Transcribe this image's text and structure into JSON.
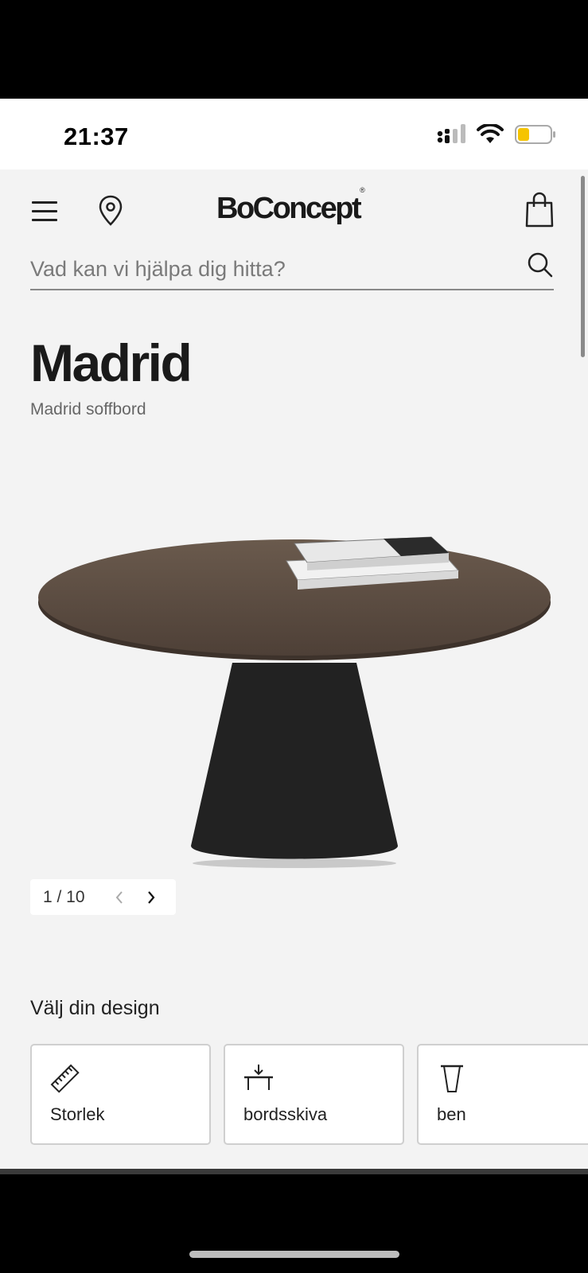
{
  "status_bar": {
    "time": "21:37",
    "icons": [
      "cellular-signal-icon",
      "wifi-icon",
      "battery-low-icon"
    ],
    "battery_color": "#f5c400"
  },
  "header": {
    "logo": "BoConcept",
    "logo_mark": "®",
    "icons": [
      "menu-icon",
      "location-pin-icon",
      "shopping-bag-icon"
    ]
  },
  "search": {
    "placeholder": "Vad kan vi hjälpa dig hitta?",
    "icon": "search-icon"
  },
  "product": {
    "title": "Madrid",
    "subtitle": "Madrid soffbord",
    "image": "round-coffee-table-with-books"
  },
  "gallery": {
    "counter": "1 / 10",
    "current": 1,
    "total": 10
  },
  "design": {
    "heading": "Välj din design",
    "options": [
      {
        "label": "Storlek",
        "icon": "ruler-icon"
      },
      {
        "label": "bordsskiva",
        "icon": "table-top-icon"
      },
      {
        "label": "ben",
        "icon": "table-leg-icon"
      }
    ]
  },
  "colors": {
    "page_background": "#f3f3f3",
    "text": "#1a1a1a",
    "table_top": "#5a4a3e",
    "table_base": "#222222"
  }
}
